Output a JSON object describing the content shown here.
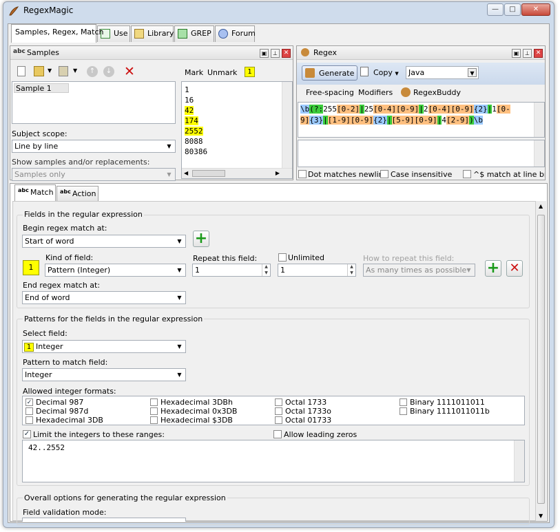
{
  "window": {
    "title": "RegexMagic"
  },
  "tabs": [
    {
      "label": "Samples, Regex, Match"
    },
    {
      "label": "Use"
    },
    {
      "label": "Library"
    },
    {
      "label": "GREP"
    },
    {
      "label": "Forum"
    }
  ],
  "samples": {
    "title": "Samples",
    "list": [
      "Sample 1"
    ],
    "subject_scope_label": "Subject scope:",
    "subject_scope": "Line by line",
    "show_label": "Show samples and/or replacements:",
    "show_value": "Samples only",
    "mark_label": "Mark",
    "unmark_label": "Unmark",
    "mark_field": "1",
    "lines": [
      {
        "text": "1",
        "highlight": false
      },
      {
        "text": "16",
        "highlight": false
      },
      {
        "text": "42",
        "highlight": true
      },
      {
        "text": "174",
        "highlight": true
      },
      {
        "text": "2552",
        "highlight": true
      },
      {
        "text": "8088",
        "highlight": false
      },
      {
        "text": "80386",
        "highlight": false
      }
    ]
  },
  "regex": {
    "title": "Regex",
    "generate_label": "Generate",
    "copy_label": "Copy",
    "flavor": "Java",
    "freespacing_label": "Free-spacing",
    "modifiers_label": "Modifiers",
    "regexbuddy_label": "RegexBuddy",
    "line1": [
      {
        "t": "\\b",
        "c": "rx-blue"
      },
      {
        "t": "(?:",
        "c": "rx-green"
      },
      {
        "t": "255",
        "c": ""
      },
      {
        "t": "[0-2]",
        "c": "rx-orange"
      },
      {
        "t": "|",
        "c": "rx-green"
      },
      {
        "t": "25",
        "c": ""
      },
      {
        "t": "[0-4]",
        "c": "rx-orange"
      },
      {
        "t": "[0-9]",
        "c": "rx-orange"
      },
      {
        "t": "|",
        "c": "rx-green"
      },
      {
        "t": "2",
        "c": ""
      },
      {
        "t": "[0-4]",
        "c": "rx-orange"
      },
      {
        "t": "[0-9]",
        "c": "rx-orange"
      },
      {
        "t": "{2}",
        "c": "rx-blue"
      },
      {
        "t": "|",
        "c": "rx-green"
      },
      {
        "t": "1",
        "c": ""
      },
      {
        "t": "[0-",
        "c": "rx-orange"
      }
    ],
    "line2": [
      {
        "t": "9]",
        "c": "rx-orange"
      },
      {
        "t": "{3}",
        "c": "rx-blue"
      },
      {
        "t": "|",
        "c": "rx-green"
      },
      {
        "t": "[1-9]",
        "c": "rx-orange"
      },
      {
        "t": "[0-9]",
        "c": "rx-orange"
      },
      {
        "t": "{2}",
        "c": "rx-blue"
      },
      {
        "t": "|",
        "c": "rx-green"
      },
      {
        "t": "[5-9]",
        "c": "rx-orange"
      },
      {
        "t": "[0-9]",
        "c": "rx-orange"
      },
      {
        "t": "|",
        "c": "rx-green"
      },
      {
        "t": "4",
        "c": ""
      },
      {
        "t": "[2-9]",
        "c": "rx-orange"
      },
      {
        "t": ")",
        "c": "rx-green"
      },
      {
        "t": "\\b",
        "c": "rx-blue"
      }
    ],
    "dot_label": "Dot matches newline",
    "case_label": "Case insensitive",
    "caret_label": "^$ match at line breal"
  },
  "match": {
    "tab_match": "Match",
    "tab_action": "Action",
    "fields_group": "Fields in the regular expression",
    "begin_label": "Begin regex match at:",
    "begin_value": "Start of word",
    "field_number": "1",
    "kind_label": "Kind of field:",
    "kind_value": "Pattern (Integer)",
    "repeat_label": "Repeat this field:",
    "repeat_value": "1",
    "unlimited_label": "Unlimited",
    "repeat_max": "1",
    "howrepeat_label": "How to repeat this field:",
    "howrepeat_value": "As many times as possible",
    "end_label": "End regex match at:",
    "end_value": "End of word",
    "patterns_group": "Patterns for the fields in the regular expression",
    "select_field_label": "Select field:",
    "select_field_number": "1",
    "select_field_value": "Integer",
    "pattern_label": "Pattern to match field:",
    "pattern_value": "Integer",
    "allowed_label": "Allowed integer formats:",
    "formats": [
      [
        {
          "label": "Decimal 987",
          "checked": true
        },
        {
          "label": "Decimal 987d",
          "checked": false
        },
        {
          "label": "Hexadecimal 3DB",
          "checked": false
        }
      ],
      [
        {
          "label": "Hexadecimal 3DBh",
          "checked": false
        },
        {
          "label": "Hexadecimal 0x3DB",
          "checked": false
        },
        {
          "label": "Hexadecimal $3DB",
          "checked": false
        }
      ],
      [
        {
          "label": "Octal 1733",
          "checked": false
        },
        {
          "label": "Octal 1733o",
          "checked": false
        },
        {
          "label": "Octal 01733",
          "checked": false
        }
      ],
      [
        {
          "label": "Binary 1111011011",
          "checked": false
        },
        {
          "label": "Binary 1111011011b",
          "checked": false
        }
      ]
    ],
    "limit_label": "Limit the integers to these ranges:",
    "leading_label": "Allow leading zeros",
    "ranges_value": "42..2552",
    "overall_group": "Overall options for generating the regular expression",
    "validation_label": "Field validation mode:"
  }
}
